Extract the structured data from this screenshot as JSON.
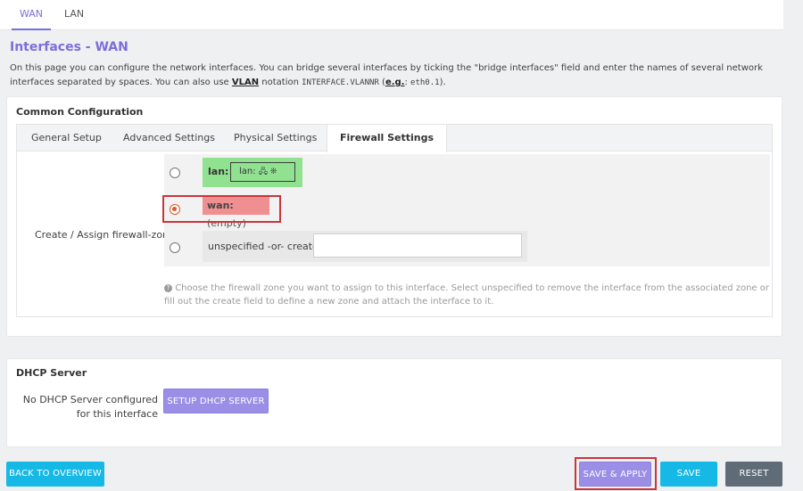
{
  "top_tabs": [
    {
      "label": "WAN",
      "active": true
    },
    {
      "label": "LAN",
      "active": false
    }
  ],
  "page": {
    "title": "Interfaces - WAN",
    "desc_part1": "On this page you can configure the network interfaces. You can bridge several interfaces by ticking the \"bridge interfaces\" field and enter the names of several network interfaces separated by spaces. You can also use ",
    "vlan_link": "VLAN",
    "desc_part2": " notation ",
    "vlan_format": "INTERFACE.VLANNR",
    "desc_part3": " (",
    "eg_link": "e.g.",
    "desc_part4": ": ",
    "eg_value": "eth0.1",
    "desc_part5": ")."
  },
  "common": {
    "title": "Common Configuration",
    "tabs": [
      "General Setup",
      "Advanced Settings",
      "Physical Settings",
      "Firewall Settings"
    ],
    "active_tab": "Firewall Settings",
    "field_label": "Create / Assign firewall-zone",
    "zones": {
      "lan_name": "lan:",
      "lan_member": "lan:",
      "lan_icons": "🖧 ❊",
      "wan_name": "wan:",
      "wan_member": "(empty)",
      "create_label": "unspecified -or- create:",
      "create_value": ""
    },
    "help_icon": "?",
    "help_text": "Choose the firewall zone you want to assign to this interface. Select unspecified to remove the interface from the associated zone or fill out the create field to define a new zone and attach the interface to it."
  },
  "dhcp": {
    "title": "DHCP Server",
    "status_line1": "No DHCP Server configured",
    "status_line2": "for this interface",
    "setup_button": "SETUP DHCP SERVER"
  },
  "footer": {
    "back": "BACK TO OVERVIEW",
    "save_apply": "SAVE & APPLY",
    "save": "SAVE",
    "reset": "RESET"
  },
  "colors": {
    "accent": "#7a6fd8",
    "highlight": "#c9353a",
    "lan_zone": "#90e290",
    "wan_zone": "#f08f8f"
  }
}
